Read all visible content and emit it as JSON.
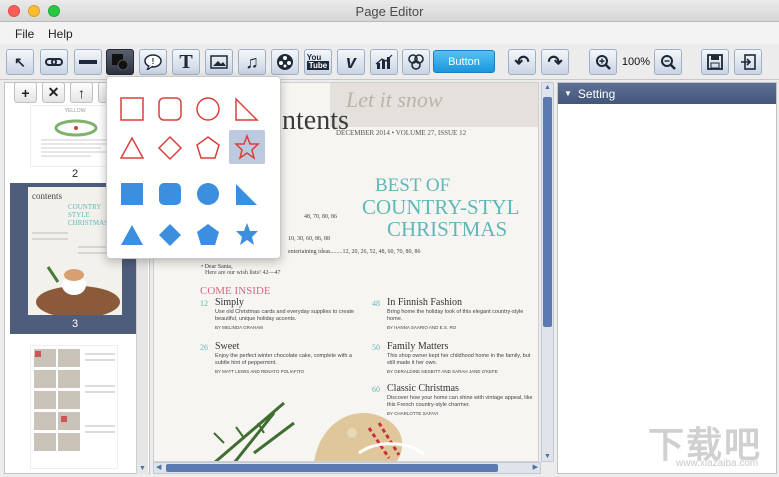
{
  "window": {
    "title": "Page Editor"
  },
  "menu": {
    "file": "File",
    "help": "Help"
  },
  "toolbar": {
    "button_label": "Button",
    "zoom": "100%",
    "tools": [
      "select-cursor-icon",
      "link-icon",
      "line-icon",
      "shape-icon",
      "comment-icon",
      "text-icon",
      "image-icon",
      "music-icon",
      "video-icon",
      "youtube-icon",
      "vimeo-icon",
      "chart-icon",
      "gallery-icon",
      "undo-icon",
      "redo-icon",
      "zoom-in-icon",
      "zoom-out-icon",
      "save-icon",
      "export-icon"
    ]
  },
  "pages_panel": {
    "actions": [
      "+",
      "✕",
      "↑",
      "↓"
    ],
    "pages": [
      {
        "number": "2"
      },
      {
        "number": "3",
        "selected": true
      },
      {
        "number": ""
      }
    ]
  },
  "shapes_popup": {
    "rows": [
      [
        "rectangle-outline",
        "rounded-rect-outline",
        "circle-outline",
        "right-triangle-outline"
      ],
      [
        "triangle-outline",
        "diamond-outline",
        "pentagon-outline",
        "star-outline"
      ],
      [
        "rectangle-filled",
        "rounded-rect-filled",
        "circle-filled",
        "right-triangle-filled"
      ],
      [
        "triangle-filled",
        "diamond-filled",
        "pentagon-filled",
        "star-filled"
      ]
    ],
    "selected": "star-outline",
    "outline_color": "#d9403b",
    "fill_color": "#3c8ede"
  },
  "settings_panel": {
    "title": "Setting"
  },
  "page": {
    "heading": "ntents",
    "issue": "DECEMBER 2014 • VOLUME 27, ISSUE 12",
    "best_of": "BEST OF",
    "country": "COUNTRY-STYL",
    "christmas": "CHRISTMAS",
    "toc_1": "48, 70, 80, 86",
    "toc_2": "10, 30, 60, 86, 88",
    "toc_3": "entertaining ideas........12, 20, 26, 52, 48, 60, 70, 80, 86",
    "dear_santa": "• Dear Santa,",
    "wish_list": "Here are our wish lists!    42—47",
    "come_inside": "COME INSIDE",
    "articles": [
      {
        "num": "12",
        "title": "Simply",
        "desc": "Use old Christmas cards and everyday supplies to create beautiful, unique holiday accents.",
        "by": "BY MELINDA GRAHAM"
      },
      {
        "num": "26",
        "title": "Sweet",
        "desc": "Enjoy the perfect winter chocolate cake, complete with a subtle hint of peppermint.",
        "by": "BY MATT LEWIS AND RENATO POLIAFITO"
      },
      {
        "num": "48",
        "title": "In Finnish Fashion",
        "desc": "Bring home the holiday look of this elegant country-style home.",
        "by": "BY HANNA SAARIO AND E.S. RO"
      },
      {
        "num": "50",
        "title": "Family Matters",
        "desc": "This shop owner kept her childhood home in the family, but still made it her own.",
        "by": "BY GERALDINE NESBITT AND SARAH JANE O'KEFE"
      },
      {
        "num": "60",
        "title": "Classic Christmas",
        "desc": "Discover how your home can shine with vintage appeal, like this French country-style charmer.",
        "by": "BY CHARLOTTE SAFAVI"
      }
    ],
    "cover_text": "Let it snow"
  },
  "thumb_texts": {
    "t1": "YELLOW",
    "t2": "contents",
    "t3": "COUNTRY STYLE CHRISTMAS"
  },
  "watermark": {
    "brand": "下载吧",
    "url": "www.xiazaiba.com"
  },
  "colors": {
    "accent": "#4f5d7c",
    "teal": "#5fb8b8",
    "pink": "#d36b84"
  }
}
